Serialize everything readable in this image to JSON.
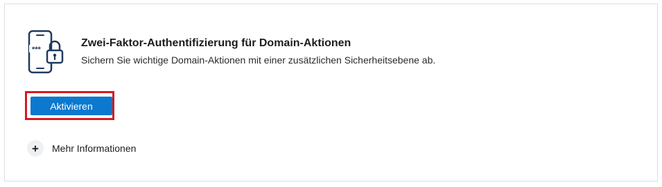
{
  "card": {
    "icon": "phone-lock-icon",
    "title": "Zwei-Faktor-Authentifizierung für Domain-Aktionen",
    "description": "Sichern Sie wichtige Domain-Aktionen mit einer zusätzlichen Sicherheitsebene ab.",
    "primary_button": "Aktivieren",
    "more_info": {
      "icon": "plus-icon",
      "symbol": "+",
      "label": "Mehr Informationen"
    }
  },
  "colors": {
    "primary": "#0b79d0",
    "icon": "#1f3a5f",
    "highlight": "#d71920"
  }
}
